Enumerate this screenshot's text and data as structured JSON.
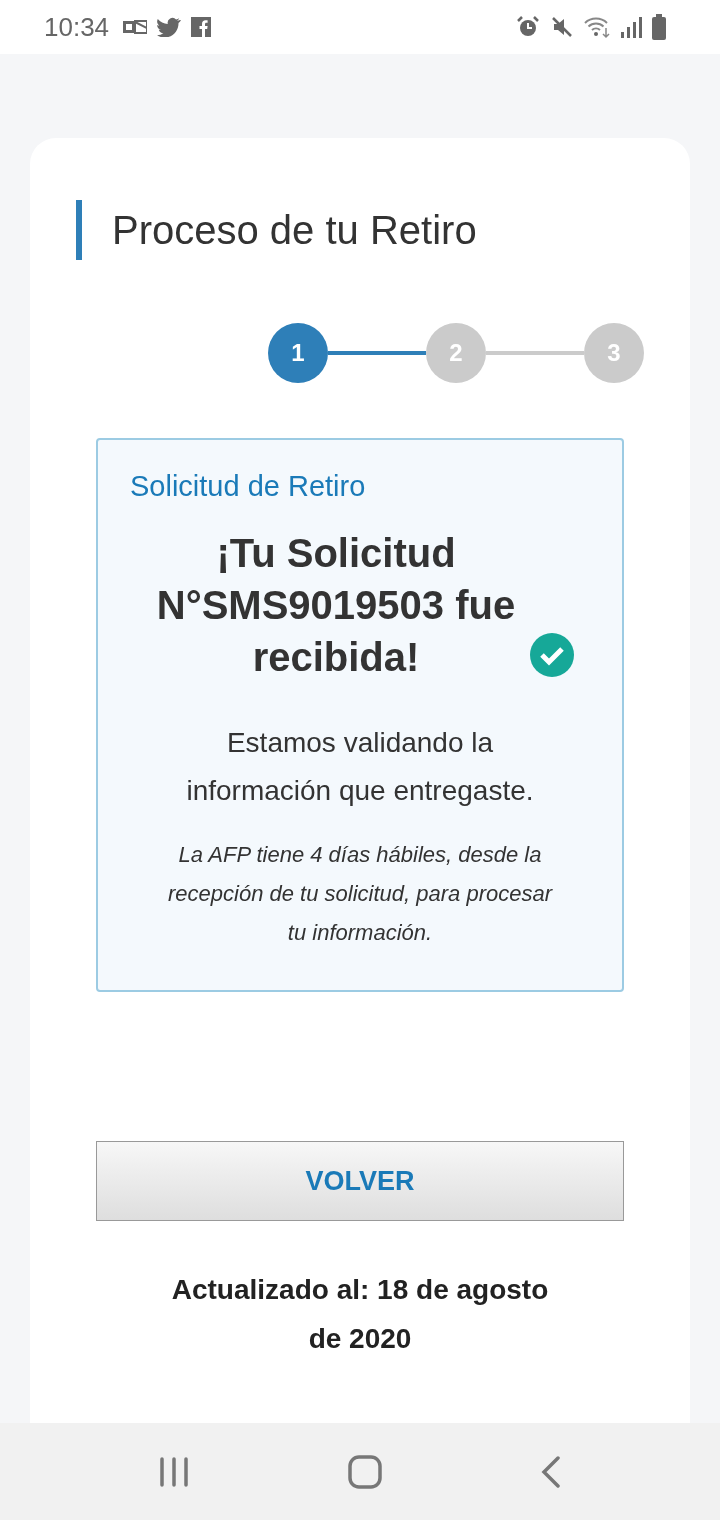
{
  "status_bar": {
    "time": "10:34"
  },
  "card": {
    "heading": "Proceso de tu Retiro",
    "steps": [
      {
        "label": "1",
        "selected": true
      },
      {
        "label": "2",
        "selected": false
      },
      {
        "label": "3",
        "selected": false
      }
    ],
    "notice": {
      "label": "Solicitud de Retiro",
      "title": "¡Tu Solicitud N°SMS9019503 fue recibida!",
      "message": "Estamos validando la información que entregaste.",
      "note": "La AFP tiene 4 días hábiles, desde la recepción de tu solicitud, para procesar tu información."
    },
    "button": "VOLVER",
    "updated": "Actualizado al: 18 de agosto de 2020"
  }
}
